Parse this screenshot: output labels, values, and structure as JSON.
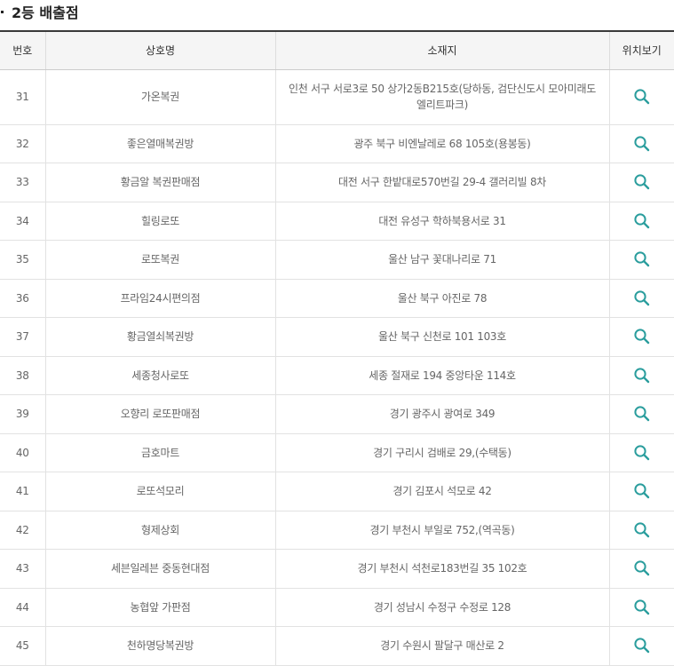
{
  "section": {
    "title": "2등 배출점"
  },
  "table": {
    "headers": {
      "no": "번호",
      "name": "상호명",
      "address": "소재지",
      "location": "위치보기"
    },
    "rows": [
      {
        "no": "31",
        "name": "가온복권",
        "address": "인천 서구 서로3로 50 상가2동B215호(당하동, 검단신도시 모아미래도 엘리트파크)"
      },
      {
        "no": "32",
        "name": "좋은열매복권방",
        "address": "광주 북구 비엔날레로 68 105호(용봉동)"
      },
      {
        "no": "33",
        "name": "황금알 복권판매점",
        "address": "대전 서구 한밭대로570번길 29-4 갤러리빌 8차"
      },
      {
        "no": "34",
        "name": "힐링로또",
        "address": "대전 유성구 학하북용서로 31"
      },
      {
        "no": "35",
        "name": "로또복권",
        "address": "울산 남구 꽃대나리로 71"
      },
      {
        "no": "36",
        "name": "프라임24시편의점",
        "address": "울산 북구 아진로 78"
      },
      {
        "no": "37",
        "name": "황금열쇠복권방",
        "address": "울산 북구 신천로 101 103호"
      },
      {
        "no": "38",
        "name": "세종청사로또",
        "address": "세종 절재로 194 중앙타운 114호"
      },
      {
        "no": "39",
        "name": "오향리 로또판매점",
        "address": "경기 광주시 광여로 349"
      },
      {
        "no": "40",
        "name": "금호마트",
        "address": "경기 구리시 검배로 29,(수택동)"
      },
      {
        "no": "41",
        "name": "로또석모리",
        "address": "경기 김포시 석모로 42"
      },
      {
        "no": "42",
        "name": "형제상회",
        "address": "경기 부천시 부일로 752,(역곡동)"
      },
      {
        "no": "43",
        "name": "세븐일레븐 중동현대점",
        "address": "경기 부천시 석천로183번길 35 102호"
      },
      {
        "no": "44",
        "name": "농협앞 가판점",
        "address": "경기 성남시 수정구 수정로 128"
      },
      {
        "no": "45",
        "name": "천하명당복권방",
        "address": "경기 수원시 팔달구 매산로 2"
      }
    ]
  },
  "icons": {
    "location": "search-icon"
  },
  "colors": {
    "icon": "#2a9d9d",
    "header_bg": "#f5f5f5",
    "top_border": "#3a3a3a"
  }
}
